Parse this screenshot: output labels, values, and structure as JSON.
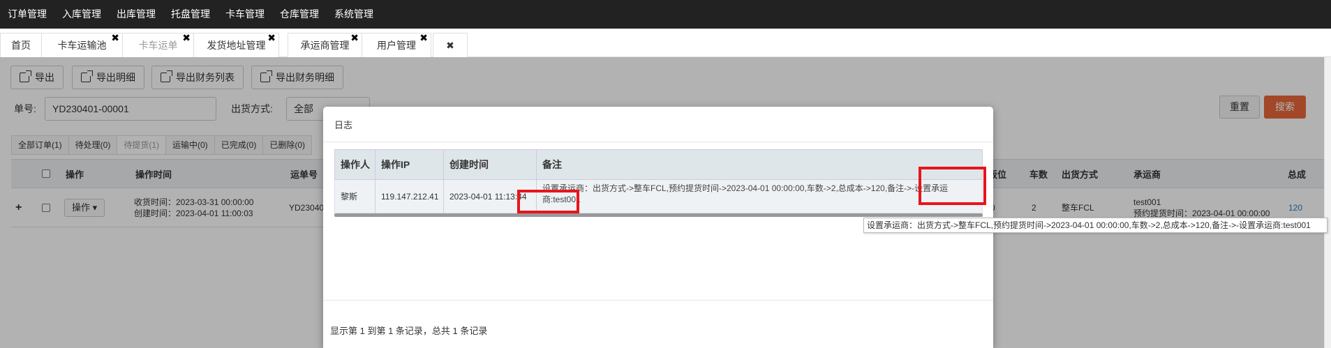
{
  "topnav": [
    "订单管理",
    "入库管理",
    "出库管理",
    "托盘管理",
    "卡车管理",
    "仓库管理",
    "系统管理"
  ],
  "tabs": [
    {
      "label": "首页",
      "closable": false
    },
    {
      "label": "卡车运输池",
      "closable": true
    },
    {
      "label": "卡车运单",
      "closable": true,
      "active": true
    },
    {
      "label": "发货地址管理",
      "closable": true
    },
    {
      "label": "承运商管理",
      "closable": true
    },
    {
      "label": "用户管理",
      "closable": true
    }
  ],
  "close_all": "✖",
  "toolbar": [
    "导出",
    "导出明细",
    "导出财务列表",
    "导出财务明细"
  ],
  "filters": {
    "order_no_label": "单号:",
    "order_no_value": "YD230401-00001",
    "ship_method_label": "出货方式:",
    "ship_method_value": "全部"
  },
  "buttons": {
    "reset": "重置",
    "search": "搜索"
  },
  "status_tabs": [
    "全部订单(1)",
    "待处理(0)",
    "待提货(1)",
    "运输中(0)",
    "已完成(0)",
    "已删除(0)"
  ],
  "grid": {
    "headers": {
      "op": "操作",
      "op_time": "操作时间",
      "waybill": "运单号",
      "slot": "板位",
      "trucks": "车数",
      "ship_method": "出货方式",
      "carrier": "承运商",
      "total": "总成"
    },
    "row": {
      "expand": "+",
      "op_btn": "操作 ▾",
      "recv_time": "收货时间：2023-03-31 00:00:00",
      "create_time": "创建时间：2023-04-01 11:00:03",
      "waybill": "YD23040",
      "slot": "0",
      "trucks": "2",
      "ship_method": "整车FCL",
      "carrier": "test001",
      "pickup": "预约提货时间：2023-04-01 00:00:00",
      "total": "120"
    }
  },
  "modal": {
    "title": "日志",
    "headers": {
      "operator": "操作人",
      "ip": "操作IP",
      "created": "创建时间",
      "note": "备注"
    },
    "row": {
      "operator": "黎斯",
      "ip": "119.147.212.41",
      "created": "2023-04-01 11:13:44",
      "note": "设置承运商：出货方式->整车FCL,预约提货时间->2023-04-01 00:00:00,车数->2,总成本->120,备注->-设置承运商:test001"
    },
    "footer": "显示第 1 到第 1 条记录，总共 1 条记录"
  },
  "tooltip": "设置承运商：出货方式->整车FCL,预约提货时间->2023-04-01 00:00:00,车数->2,总成本->120,备注->-设置承运商:test001"
}
